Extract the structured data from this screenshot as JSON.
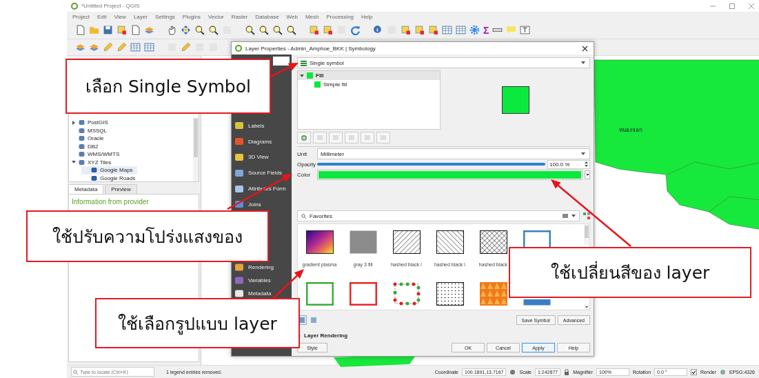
{
  "window": {
    "title": "*Untitled Project - QGIS"
  },
  "menu": [
    {
      "label": "Project"
    },
    {
      "label": "Edit"
    },
    {
      "label": "View"
    },
    {
      "label": "Layer"
    },
    {
      "label": "Settings"
    },
    {
      "label": "Plugins"
    },
    {
      "label": "Vector"
    },
    {
      "label": "Raster"
    },
    {
      "label": "Database"
    },
    {
      "label": "Web"
    },
    {
      "label": "Mesh"
    },
    {
      "label": "Processing"
    },
    {
      "label": "Help"
    }
  ],
  "statistics_glyph": "Σ",
  "browser": {
    "items": [
      {
        "label": "PostGIS",
        "expanded": false,
        "selected": false
      },
      {
        "label": "MSSQL",
        "selected": false
      },
      {
        "label": "Oracle",
        "selected": false
      },
      {
        "label": "DB2",
        "selected": false
      },
      {
        "label": "WMS/WMTS",
        "selected": false
      },
      {
        "label": "XYZ Tiles",
        "expanded": true,
        "selected": false,
        "children": [
          {
            "label": "Google Maps",
            "selected": true
          },
          {
            "label": "Google Roads",
            "selected": false
          }
        ]
      }
    ],
    "tabs": [
      {
        "label": "Metadata",
        "selected": true
      },
      {
        "label": "Preview",
        "selected": false
      }
    ],
    "info": "Information from provider"
  },
  "map": {
    "labels": [
      {
        "text": "หนองจอก"
      }
    ]
  },
  "dialog": {
    "title": "Layer Properties - Admin_Amphoe_BKK | Symbology",
    "sidebar": [
      {
        "label": "Labels",
        "selected": false
      },
      {
        "label": "Diagrams",
        "selected": false
      },
      {
        "label": "3D View",
        "selected": false
      },
      {
        "label": "Source Fields",
        "selected": false
      },
      {
        "label": "Attributes Form",
        "selected": false
      },
      {
        "label": "Joins",
        "selected": false
      }
    ],
    "sidebar_lower": [
      {
        "label": "Rendering",
        "selected": false
      },
      {
        "label": "Variables",
        "selected": false
      },
      {
        "label": "Metadata",
        "selected": false
      }
    ],
    "renderer": "Single symbol",
    "symbol_layers": [
      {
        "label": "Fill",
        "expanded": true,
        "children": [
          {
            "label": "Simple fill"
          }
        ]
      }
    ],
    "unit": {
      "label": "Unit",
      "value": "Millimeter"
    },
    "opacity": {
      "label": "Opacity",
      "level": 1,
      "reading": "100.0 %"
    },
    "color": {
      "label": "Color",
      "color": "#0be83e"
    },
    "library": {
      "value": "Favorites"
    },
    "symbols": [
      {
        "label": "gradient plasma",
        "kind": "gradient"
      },
      {
        "label": "gray 3 fill",
        "kind": "solid",
        "color": "#8c8c8c"
      },
      {
        "label": "hashed black /",
        "kind": "hatch_fwd"
      },
      {
        "label": "hashed black \\",
        "kind": "hatch_back"
      },
      {
        "label": "hashed black",
        "kind": "crosshatch"
      },
      {
        "kind": "outline",
        "color": "#3a7fc4"
      },
      {
        "kind": "outline",
        "color": "#3cad3c"
      },
      {
        "kind": "outline",
        "color": "#e8262b"
      },
      {
        "kind": "dot_border"
      },
      {
        "kind": "dots"
      },
      {
        "kind": "triangles"
      },
      {
        "kind": "solid",
        "color": "#3a7fc4"
      }
    ],
    "save_symbol": "Save Symbol",
    "advanced": "Advanced",
    "layer_rendering": {
      "label": "Layer Rendering",
      "expanded": false
    },
    "style": "Style",
    "buttons": [
      {
        "label": "OK",
        "default": false
      },
      {
        "label": "Cancel",
        "default": false
      },
      {
        "label": "Apply",
        "default": true
      },
      {
        "label": "Help",
        "default": false
      }
    ]
  },
  "status_bar": {
    "locate_placeholder": "Type to locate (Ctrl+K)",
    "message": "1 legend entries removed.",
    "coordinate_label": "Coordinate",
    "coordinate": "100.1891,13.7167",
    "scale_label": "Scale",
    "scale": "1:242877",
    "magnifier_label": "Magnifier",
    "magnifier": "100%",
    "rotation_label": "Rotation",
    "rotation": "0.0 °",
    "render": {
      "label": "Render",
      "checked": true
    },
    "crs": "EPSG:4326"
  },
  "callouts": [
    {
      "text": "เลือก Single Symbol"
    },
    {
      "text": "ใช้ปรับความโปร่งแสงของ"
    },
    {
      "text": "ใช้เลือกรูปแบบ layer"
    },
    {
      "text": "ใช้เปลี่ยนสีของ layer"
    }
  ]
}
